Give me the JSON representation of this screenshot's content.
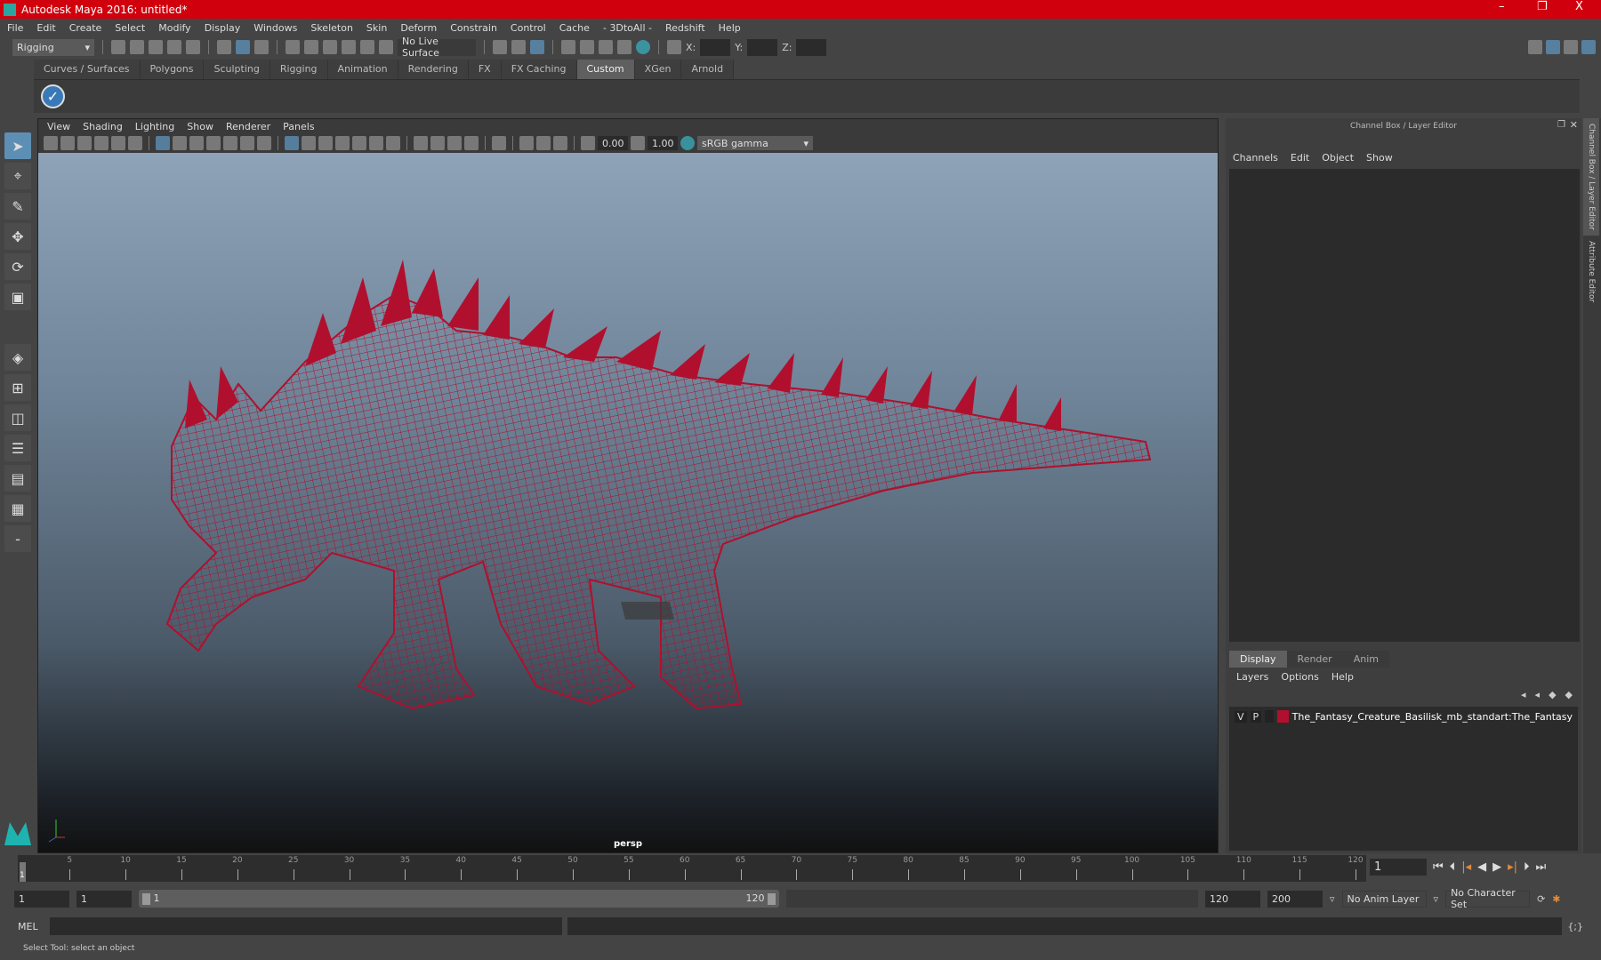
{
  "window": {
    "title": "Autodesk Maya 2016: untitled*",
    "minimize": "–",
    "restore": "❐",
    "close": "X"
  },
  "menu": [
    "File",
    "Edit",
    "Create",
    "Select",
    "Modify",
    "Display",
    "Windows",
    "Skeleton",
    "Skin",
    "Deform",
    "Constrain",
    "Control",
    "Cache",
    "- 3DtoAll -",
    "Redshift",
    "Help"
  ],
  "toolbar": {
    "mode": "Rigging",
    "live_surface": "No Live Surface",
    "x_label": "X:",
    "y_label": "Y:",
    "z_label": "Z:"
  },
  "shelf_tabs": [
    "Curves / Surfaces",
    "Polygons",
    "Sculpting",
    "Rigging",
    "Animation",
    "Rendering",
    "FX",
    "FX Caching",
    "Custom",
    "XGen",
    "Arnold"
  ],
  "shelf_active": "Custom",
  "viewport": {
    "menu": [
      "View",
      "Shading",
      "Lighting",
      "Show",
      "Renderer",
      "Panels"
    ],
    "exposure": "0.00",
    "gamma": "1.00",
    "color_space": "sRGB gamma",
    "camera": "persp",
    "accent": "#b0102e"
  },
  "channel_box": {
    "title": "Channel Box / Layer Editor",
    "menu": [
      "Channels",
      "Edit",
      "Object",
      "Show"
    ]
  },
  "layer_editor": {
    "tabs": [
      "Display",
      "Render",
      "Anim"
    ],
    "menu": [
      "Layers",
      "Options",
      "Help"
    ],
    "layer": {
      "v": "V",
      "p": "P",
      "name": "The_Fantasy_Creature_Basilisk_mb_standart:The_Fantasy",
      "color": "#b0102e"
    }
  },
  "side_tabs": [
    "Channel Box / Layer Editor",
    "Attribute Editor"
  ],
  "timeline": {
    "ticks": [
      5,
      10,
      15,
      20,
      25,
      30,
      35,
      40,
      45,
      50,
      55,
      60,
      65,
      70,
      75,
      80,
      85,
      90,
      95,
      100,
      105,
      110,
      115,
      120
    ],
    "current": "1",
    "current_frame_field": "1"
  },
  "range": {
    "start": "1",
    "playback_start": "1",
    "slider_start": "1",
    "slider_end": "120",
    "playback_end": "120",
    "end": "200",
    "anim_layer": "No Anim Layer",
    "character_set": "No Character Set"
  },
  "command": {
    "label": "MEL"
  },
  "status": "Select Tool: select an object"
}
